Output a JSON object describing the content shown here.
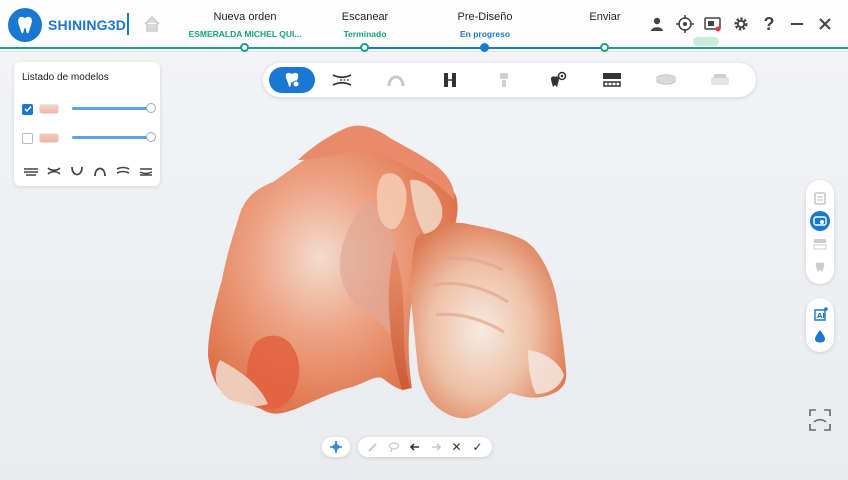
{
  "app": {
    "logo_text": "SHINING3D",
    "brand_color": "#1a78d2",
    "accent_green": "#1aa17f"
  },
  "steps": [
    {
      "title": "Nueva orden",
      "status": "ESMERALDA MICHEL QUI...",
      "state": "done"
    },
    {
      "title": "Escanear",
      "status": "Terminado",
      "state": "done"
    },
    {
      "title": "Pre-Diseño",
      "status": "En progreso",
      "state": "active"
    },
    {
      "title": "Enviar",
      "status": "",
      "state": "pending"
    }
  ],
  "window_icons": [
    "user-icon",
    "target-icon",
    "screen-record-icon",
    "gear-icon",
    "help-icon",
    "minimize-icon",
    "close-icon"
  ],
  "model_list": {
    "title": "Listado de modelos",
    "models": [
      {
        "checked": true,
        "opacity_percent": 100,
        "jaw": "upper"
      },
      {
        "checked": false,
        "opacity_percent": 100,
        "jaw": "lower"
      }
    ],
    "view_icons": [
      "view-top-icon",
      "view-front-icon",
      "view-back-icon",
      "view-arch-icon",
      "view-left-icon",
      "view-right-icon"
    ]
  },
  "toolbar": {
    "tools": [
      {
        "icon": "tooth-scan-icon",
        "active": true
      },
      {
        "icon": "trim-icon",
        "active": false
      },
      {
        "icon": "arch-icon",
        "active": false,
        "disabled": true
      },
      {
        "icon": "align-icon",
        "active": false
      },
      {
        "icon": "implant-icon",
        "active": false,
        "disabled": true
      },
      {
        "icon": "tooth-view-icon",
        "active": false
      },
      {
        "icon": "bite-icon",
        "active": false
      },
      {
        "icon": "tray-icon",
        "active": false,
        "disabled": true
      },
      {
        "icon": "model-icon",
        "active": false,
        "disabled": true
      }
    ]
  },
  "side_panels": {
    "top": [
      "clipboard-icon",
      "scan-view-icon",
      "occlusion-icon",
      "tooth-icon"
    ],
    "bottom": [
      "ai-icon",
      "water-drop-icon"
    ]
  },
  "bottom_toolbar": {
    "tools": [
      "brush-icon",
      "lasso-icon",
      "undo-icon",
      "redo-icon",
      "cancel-icon",
      "confirm-icon"
    ],
    "cancel_label": "✕",
    "confirm_label": "✓"
  }
}
